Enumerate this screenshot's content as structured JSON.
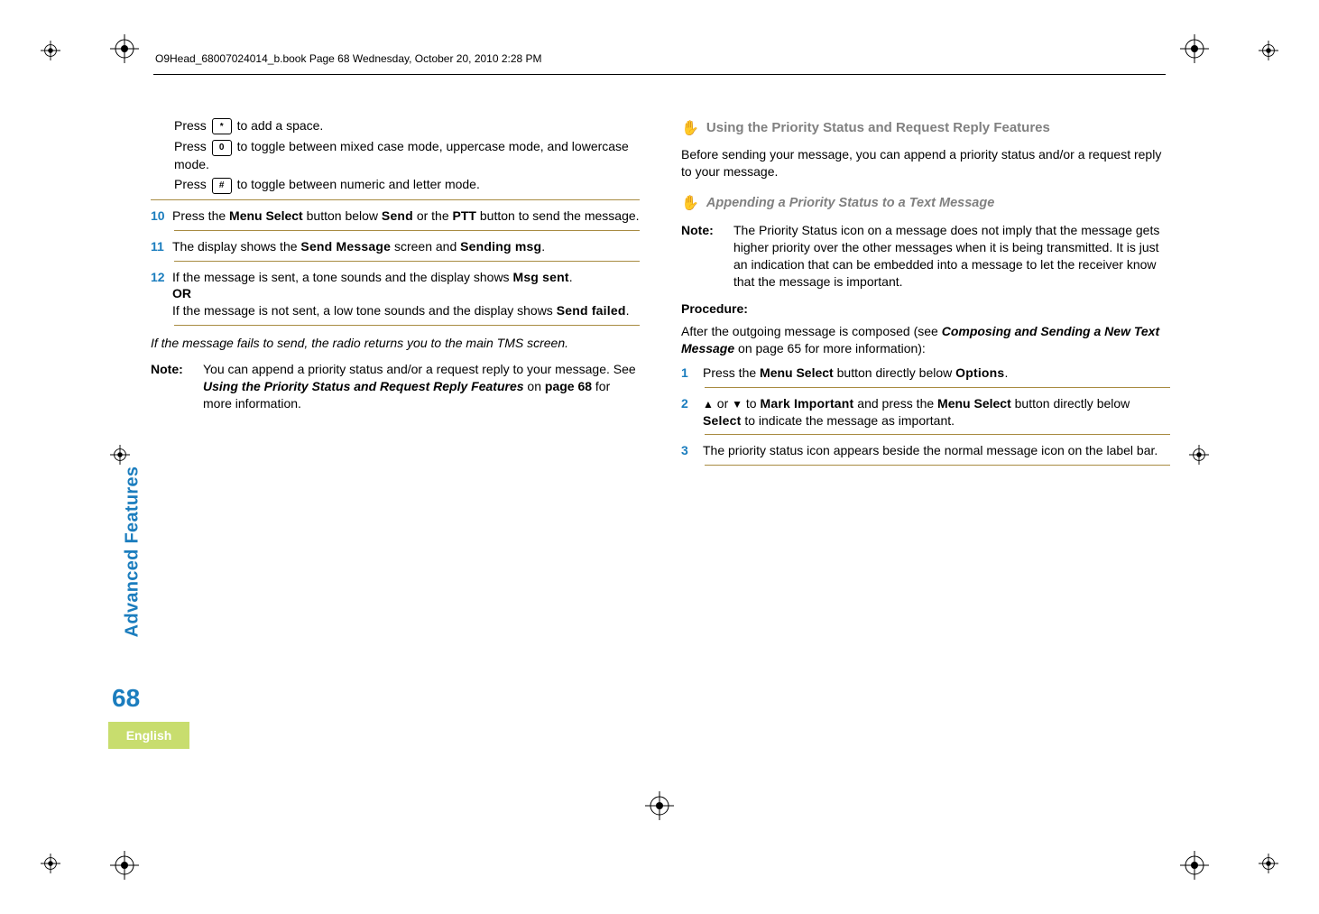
{
  "header": {
    "text": "O9Head_68007024014_b.book  Page 68  Wednesday, October 20, 2010  2:28 PM"
  },
  "keys": {
    "star": "*",
    "zero": "0",
    "hash": "#"
  },
  "left": {
    "p1a": "Press ",
    "p1b": " to add a space.",
    "p2a": "Press ",
    "p2b": " to toggle between mixed case mode, uppercase mode, and lowercase mode.",
    "p3a": "Press ",
    "p3b": " to toggle between numeric and letter mode.",
    "s10": {
      "num": "10",
      "a": "Press the ",
      "b": "Menu Select",
      "c": " button below ",
      "d": "Send",
      "e": " or the ",
      "f": "PTT",
      "g": " button to send the message."
    },
    "s11": {
      "num": "11",
      "a": "The display shows the ",
      "b": "Send Message",
      "c": " screen and ",
      "d": "Sending msg",
      "e": "."
    },
    "s12": {
      "num": "12",
      "a": "If the message is sent, a tone sounds and the display shows ",
      "b": "Msg sent",
      "c": ".",
      "or": "OR",
      "d": "If the message is not sent, a low tone sounds and the display shows ",
      "e": "Send failed",
      "f": "."
    },
    "fail": "If the message fails to send, the radio returns you to the main TMS screen.",
    "note": {
      "label": "Note:",
      "a": "You can append a priority status and/or a request reply to your message. See ",
      "b": "Using the Priority Status and Request Reply Features",
      "c": " on ",
      "d": "page 68",
      "e": " for more information."
    }
  },
  "right": {
    "h3": "Using the Priority Status and Request Reply Features",
    "intro": "Before sending your message, you can append a priority status and/or a request reply to your message.",
    "h4": "Appending a Priority Status to a Text Message",
    "note": {
      "label": "Note:",
      "body": "The Priority Status icon on a message does not imply that the message gets higher priority over the other messages when it is being transmitted. It is just an indication that can be embedded into a message to let the receiver know that the message is important."
    },
    "proc": "Procedure:",
    "after": {
      "a": "After the outgoing message is composed (see ",
      "b": "Composing and Sending a New Text Message",
      "c": " on page 65 for more information):"
    },
    "s1": {
      "num": "1",
      "a": "Press the ",
      "b": "Menu Select",
      "c": " button directly below ",
      "d": "Options",
      "e": "."
    },
    "s2": {
      "num": "2",
      "up": "▲",
      "or": " or ",
      "down": "▼",
      "a": " to ",
      "b": "Mark Important",
      "c": " and press the ",
      "d": "Menu Select",
      "e": " button directly below ",
      "f": "Select",
      "g": " to indicate the message as important."
    },
    "s3": {
      "num": "3",
      "body": "The priority status icon appears beside the normal message icon on the label bar."
    }
  },
  "sidebar": {
    "label": "Advanced Features",
    "page": "68",
    "lang": "English"
  }
}
